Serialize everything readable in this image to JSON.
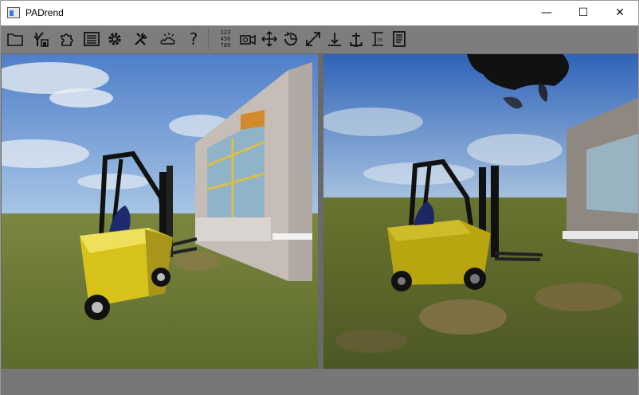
{
  "window": {
    "title": "PADrend",
    "controls": {
      "minimize": "—",
      "maximize": "☐",
      "close": "✕"
    }
  },
  "toolbar": {
    "buttons": [
      {
        "name": "open-folder-icon"
      },
      {
        "name": "scene-tree-icon"
      },
      {
        "name": "plugins-puzzle-icon"
      },
      {
        "name": "list-panel-icon"
      },
      {
        "name": "settings-gear-icon"
      },
      {
        "name": "tools-icon"
      },
      {
        "name": "weather-effects-icon"
      },
      {
        "name": "help-icon",
        "label": "?"
      },
      {
        "name": "numeric-keypad-icon",
        "label": "123\n456\n789"
      },
      {
        "name": "camera-icon"
      },
      {
        "name": "move-icon"
      },
      {
        "name": "rotate-icon"
      },
      {
        "name": "scale-icon"
      },
      {
        "name": "snap-down-icon"
      },
      {
        "name": "anchor-icon"
      },
      {
        "name": "measure-icon"
      },
      {
        "name": "notes-panel-icon"
      }
    ]
  },
  "viewports": [
    {
      "name": "left-viewport",
      "variant": "rendered"
    },
    {
      "name": "right-viewport",
      "variant": "point-cloud"
    }
  ],
  "colors": {
    "toolbar_bg": "#7d7d7d",
    "statusbar_bg": "#777777",
    "sky_top": "#4f7ec9",
    "grass": "#6e7a35",
    "forklift_yellow": "#d7c21a"
  }
}
